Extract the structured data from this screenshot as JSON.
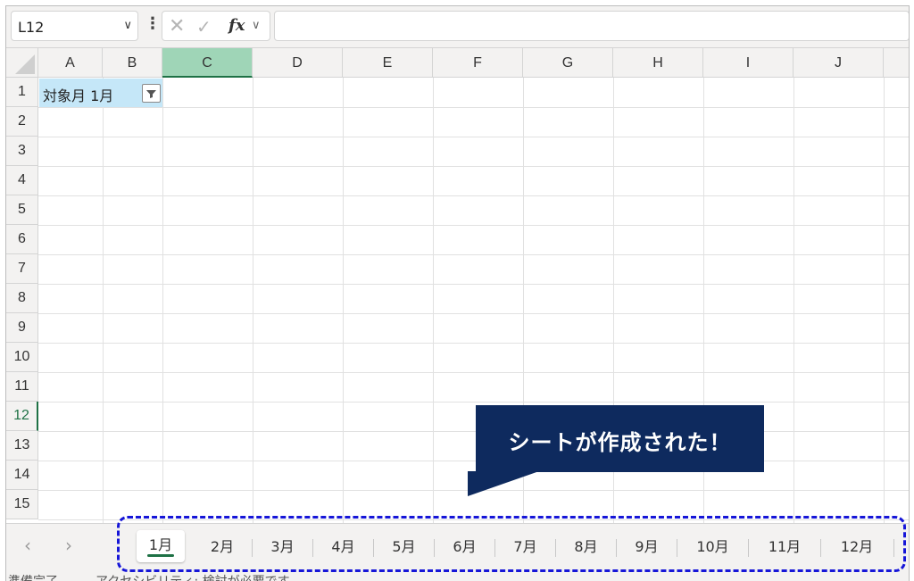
{
  "formula_bar": {
    "name_box": "L12",
    "cancel_icon": "close-icon",
    "enter_icon": "check-icon",
    "fx_label": "fx",
    "formula_value": ""
  },
  "columns": [
    "A",
    "B",
    "C",
    "D",
    "E",
    "F",
    "G",
    "H",
    "I",
    "J"
  ],
  "selected_column": "C",
  "rows": [
    "1",
    "2",
    "3",
    "4",
    "5",
    "6",
    "7",
    "8",
    "9",
    "10",
    "11",
    "12",
    "13",
    "14",
    "15"
  ],
  "selected_row": "12",
  "cells": {
    "a1": "対象月  1月"
  },
  "sheet_tabs": [
    "1月",
    "2月",
    "3月",
    "4月",
    "5月",
    "6月",
    "7月",
    "8月",
    "9月",
    "10月",
    "11月",
    "12月"
  ],
  "active_tab": "1月",
  "status": {
    "ready": "準備完了",
    "accessibility": "アクセシビリティ: 検討が必要です"
  },
  "callout": {
    "text": "シートが作成された！"
  },
  "colors": {
    "accent_green": "#1e7145",
    "selected_header": "#9fd5b7",
    "cell_fill": "#c5e7f8",
    "callout_bg": "#0e2a5e",
    "dash_outline": "#1616d8"
  }
}
